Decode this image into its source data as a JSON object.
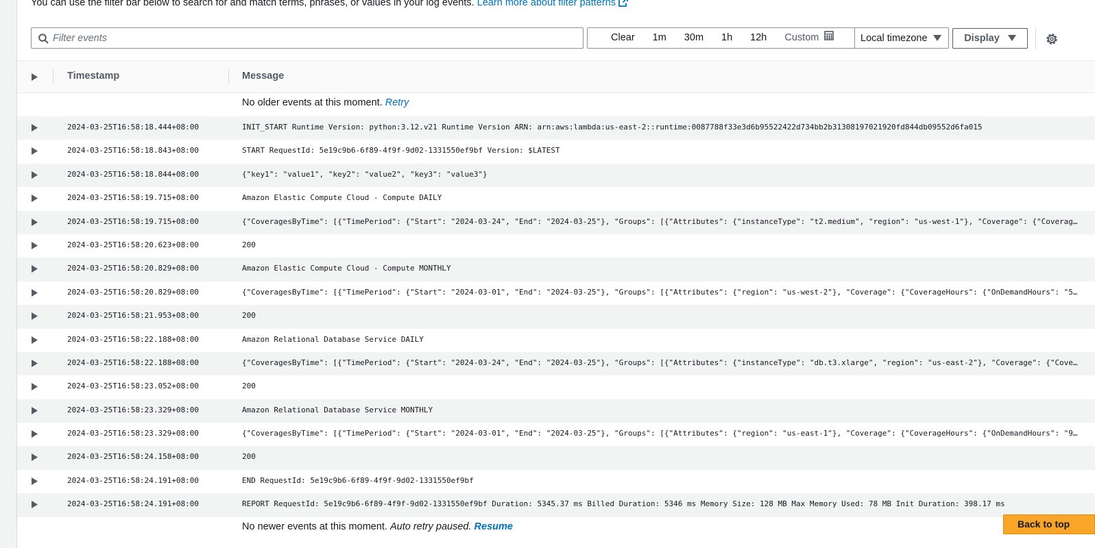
{
  "intro": {
    "text": "You can use the filter bar below to search for and match terms, phrases, or values in your log events.",
    "link": "Learn more about filter patterns"
  },
  "filter": {
    "placeholder": "Filter events",
    "value": ""
  },
  "time_range": {
    "clear": "Clear",
    "options": [
      "1m",
      "30m",
      "1h",
      "12h"
    ],
    "custom": "Custom",
    "timezone": "Local timezone"
  },
  "display_button": "Display",
  "table": {
    "headers": {
      "timestamp": "Timestamp",
      "message": "Message"
    },
    "older": {
      "text": "No older events at this moment.",
      "link": "Retry"
    },
    "newer": {
      "text": "No newer events at this moment.",
      "status": "Auto retry paused.",
      "link": "Resume"
    },
    "rows": [
      {
        "ts": "2024-03-25T16:58:18.444+08:00",
        "msg": "INIT_START Runtime Version: python:3.12.v21 Runtime Version ARN: arn:aws:lambda:us-east-2::runtime:0087788f33e3d6b95522422d734bb2b31308197021920fd844db09552d6fa015"
      },
      {
        "ts": "2024-03-25T16:58:18.843+08:00",
        "msg": "START RequestId: 5e19c9b6-6f89-4f9f-9d02-1331550ef9bf Version: $LATEST"
      },
      {
        "ts": "2024-03-25T16:58:18.844+08:00",
        "msg": "{\"key1\": \"value1\", \"key2\": \"value2\", \"key3\": \"value3\"}"
      },
      {
        "ts": "2024-03-25T16:58:19.715+08:00",
        "msg": "Amazon Elastic Compute Cloud - Compute DAILY"
      },
      {
        "ts": "2024-03-25T16:58:19.715+08:00",
        "msg": "{\"CoveragesByTime\": [{\"TimePeriod\": {\"Start\": \"2024-03-24\", \"End\": \"2024-03-25\"}, \"Groups\": [{\"Attributes\": {\"instanceType\": \"t2.medium\", \"region\": \"us-west-1\"}, \"Coverage\": {\"Coverag…"
      },
      {
        "ts": "2024-03-25T16:58:20.623+08:00",
        "msg": "200"
      },
      {
        "ts": "2024-03-25T16:58:20.829+08:00",
        "msg": "Amazon Elastic Compute Cloud - Compute MONTHLY"
      },
      {
        "ts": "2024-03-25T16:58:20.829+08:00",
        "msg": "{\"CoveragesByTime\": [{\"TimePeriod\": {\"Start\": \"2024-03-01\", \"End\": \"2024-03-25\"}, \"Groups\": [{\"Attributes\": {\"region\": \"us-west-2\"}, \"Coverage\": {\"CoverageHours\": {\"OnDemandHours\": \"5…"
      },
      {
        "ts": "2024-03-25T16:58:21.953+08:00",
        "msg": "200"
      },
      {
        "ts": "2024-03-25T16:58:22.188+08:00",
        "msg": "Amazon Relational Database Service DAILY"
      },
      {
        "ts": "2024-03-25T16:58:22.188+08:00",
        "msg": "{\"CoveragesByTime\": [{\"TimePeriod\": {\"Start\": \"2024-03-24\", \"End\": \"2024-03-25\"}, \"Groups\": [{\"Attributes\": {\"instanceType\": \"db.t3.xlarge\", \"region\": \"us-east-2\"}, \"Coverage\": {\"Cove…"
      },
      {
        "ts": "2024-03-25T16:58:23.052+08:00",
        "msg": "200"
      },
      {
        "ts": "2024-03-25T16:58:23.329+08:00",
        "msg": "Amazon Relational Database Service MONTHLY"
      },
      {
        "ts": "2024-03-25T16:58:23.329+08:00",
        "msg": "{\"CoveragesByTime\": [{\"TimePeriod\": {\"Start\": \"2024-03-01\", \"End\": \"2024-03-25\"}, \"Groups\": [{\"Attributes\": {\"region\": \"us-east-1\"}, \"Coverage\": {\"CoverageHours\": {\"OnDemandHours\": \"9…"
      },
      {
        "ts": "2024-03-25T16:58:24.158+08:00",
        "msg": "200"
      },
      {
        "ts": "2024-03-25T16:58:24.191+08:00",
        "msg": "END RequestId: 5e19c9b6-6f89-4f9f-9d02-1331550ef9bf"
      },
      {
        "ts": "2024-03-25T16:58:24.191+08:00",
        "msg": "REPORT RequestId: 5e19c9b6-6f89-4f9f-9d02-1331550ef9bf Duration: 5345.37 ms Billed Duration: 5346 ms Memory Size: 128 MB Max Memory Used: 78 MB Init Duration: 398.17 ms"
      }
    ]
  },
  "back_to_top": "Back to top",
  "colors": {
    "link": "#0073bb",
    "accent": "#f8a52a",
    "row_alt": "#f2f3f3"
  },
  "icons": [
    "external-link-icon",
    "search-icon",
    "calendar-icon",
    "caret-down-icon",
    "settings-gear-icon",
    "expand-caret-icon"
  ]
}
